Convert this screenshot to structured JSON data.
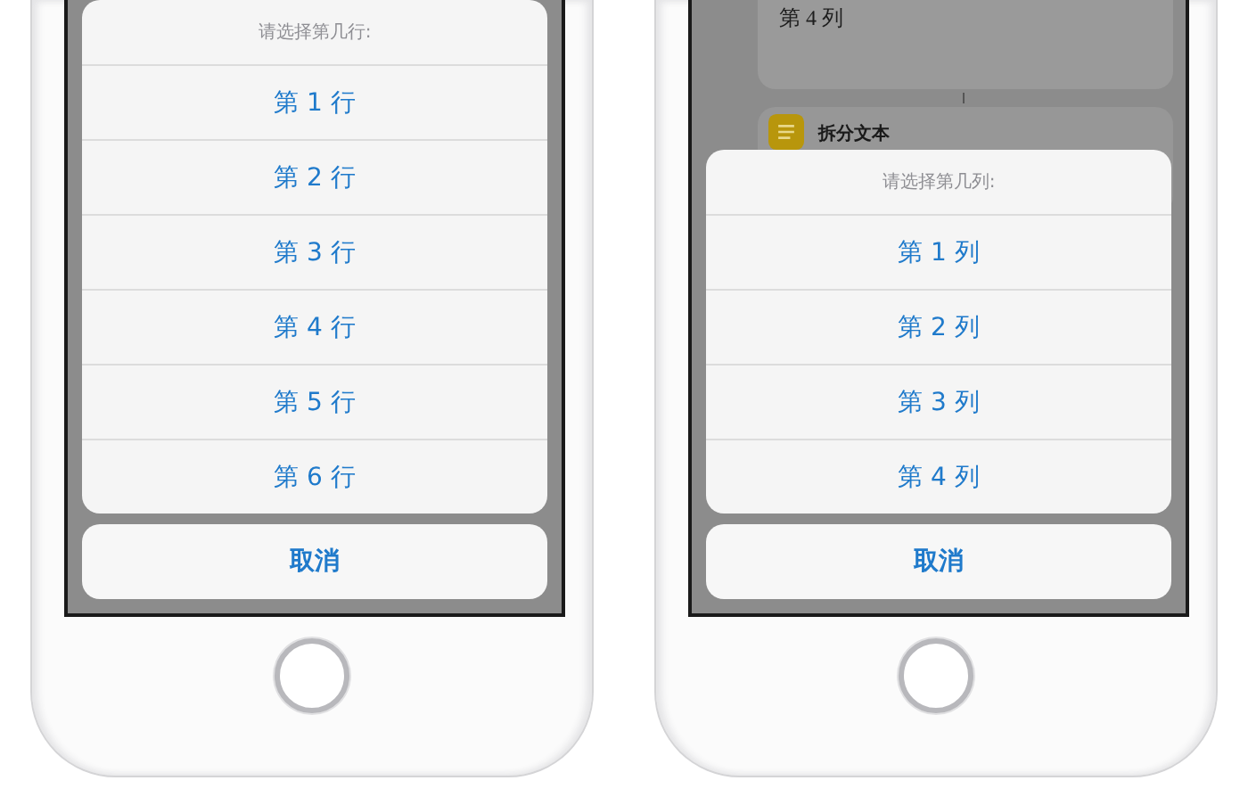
{
  "phones": [
    {
      "sheet": {
        "title": "请选择第几行:",
        "options": [
          "第 1 行",
          "第 2 行",
          "第 3 行",
          "第 4 行",
          "第 5 行",
          "第 6 行"
        ],
        "cancel": "取消"
      }
    },
    {
      "background": {
        "card_text": "第 4 列",
        "action_title": "拆分文本"
      },
      "sheet": {
        "title": "请选择第几列:",
        "options": [
          "第 1 列",
          "第 2 列",
          "第 3 列",
          "第 4 列"
        ],
        "cancel": "取消"
      }
    }
  ]
}
